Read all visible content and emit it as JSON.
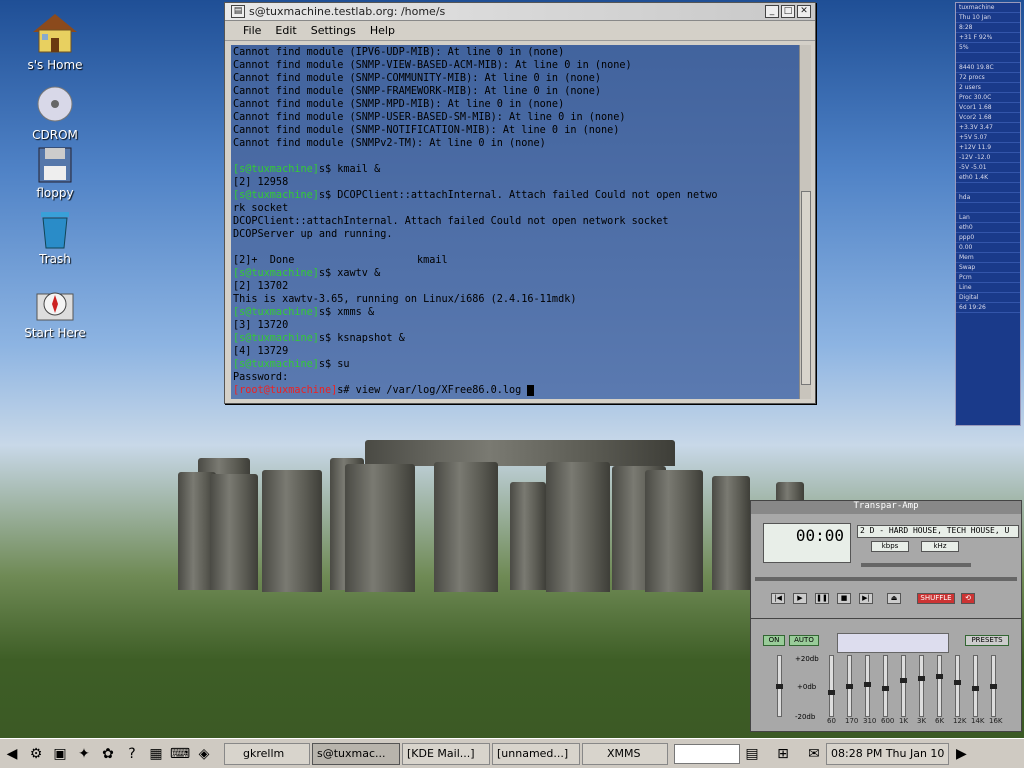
{
  "desktop": {
    "icons": [
      {
        "label": "s's Home",
        "icon": "home-icon"
      },
      {
        "label": "CDROM",
        "icon": "cdrom-icon"
      },
      {
        "label": "floppy",
        "icon": "floppy-icon"
      },
      {
        "label": "Trash",
        "icon": "trash-icon"
      },
      {
        "label": "Start Here",
        "icon": "start-here-icon"
      }
    ]
  },
  "terminal": {
    "title": "s@tuxmachine.testlab.org: /home/s",
    "menu": [
      "File",
      "Edit",
      "Settings",
      "Help"
    ],
    "lines": [
      {
        "prefix": "",
        "text": "Cannot find module (IPV6-UDP-MIB): At line 0 in (none)"
      },
      {
        "prefix": "",
        "text": "Cannot find module (SNMP-VIEW-BASED-ACM-MIB): At line 0 in (none)"
      },
      {
        "prefix": "",
        "text": "Cannot find module (SNMP-COMMUNITY-MIB): At line 0 in (none)"
      },
      {
        "prefix": "",
        "text": "Cannot find module (SNMP-FRAMEWORK-MIB): At line 0 in (none)"
      },
      {
        "prefix": "",
        "text": "Cannot find module (SNMP-MPD-MIB): At line 0 in (none)"
      },
      {
        "prefix": "",
        "text": "Cannot find module (SNMP-USER-BASED-SM-MIB): At line 0 in (none)"
      },
      {
        "prefix": "",
        "text": "Cannot find module (SNMP-NOTIFICATION-MIB): At line 0 in (none)"
      },
      {
        "prefix": "",
        "text": "Cannot find module (SNMPv2-TM): At line 0 in (none)"
      },
      {
        "prefix": "",
        "text": ""
      },
      {
        "prefix": "[s@tuxmachine]",
        "text": "s$ kmail &"
      },
      {
        "prefix": "",
        "text": "[2] 12958"
      },
      {
        "prefix": "[s@tuxmachine]",
        "text": "s$ DCOPClient::attachInternal. Attach failed Could not open netwo"
      },
      {
        "prefix": "",
        "text": "rk socket"
      },
      {
        "prefix": "",
        "text": "DCOPClient::attachInternal. Attach failed Could not open network socket"
      },
      {
        "prefix": "",
        "text": "DCOPServer up and running."
      },
      {
        "prefix": "",
        "text": ""
      },
      {
        "prefix": "",
        "text": "[2]+  Done                    kmail"
      },
      {
        "prefix": "[s@tuxmachine]",
        "text": "s$ xawtv &"
      },
      {
        "prefix": "",
        "text": "[2] 13702"
      },
      {
        "prefix": "",
        "text": "This is xawtv-3.65, running on Linux/i686 (2.4.16-11mdk)"
      },
      {
        "prefix": "[s@tuxmachine]",
        "text": "s$ xmms &"
      },
      {
        "prefix": "",
        "text": "[3] 13720"
      },
      {
        "prefix": "[s@tuxmachine]",
        "text": "s$ ksnapshot &"
      },
      {
        "prefix": "",
        "text": "[4] 13729"
      },
      {
        "prefix": "[s@tuxmachine]",
        "text": "s$ su"
      },
      {
        "prefix": "",
        "text": "Password:"
      },
      {
        "prefix": "[root@tuxmachine]",
        "text": "s# view /var/log/XFree86.0.log "
      }
    ]
  },
  "gkrellm": {
    "lines": [
      "tuxmachine",
      "Thu 10 Jan",
      "8:28",
      "+31 F  92%",
      "5%",
      "",
      "8440    19.8C",
      "72 procs",
      "2 users",
      "Proc   30.0C",
      "Vcor1   1.68",
      "Vcor2   1.68",
      "+3.3V   3.47",
      "+5V     5.07",
      "+12V    11.9",
      "-12V   -12.0",
      "-5V    -5.01",
      "eth0    1.4K",
      "",
      "hda",
      "",
      "Lan",
      "eth0",
      "ppp0",
      "0.00",
      "Mem",
      "Swap",
      "Pcm",
      "Line",
      "Digital",
      "6d 19:26"
    ]
  },
  "xmms": {
    "title": "Transpar-Amp",
    "time": "00:00",
    "song": "2 D - HARD HOUSE, TECH HOUSE, U",
    "kbps": "kbps",
    "khz": "kHz",
    "shuffle": "SHUFFLE",
    "eq_on": "ON",
    "eq_auto": "AUTO",
    "presets": "PRESETS",
    "db_top": "+20db",
    "db_mid": "+0db",
    "db_bot": "-20db",
    "bands": [
      "60",
      "170",
      "310",
      "600",
      "1K",
      "3K",
      "6K",
      "12K",
      "14K",
      "16K"
    ]
  },
  "taskbar": {
    "tasks": [
      "gkrellm",
      "s@tuxmac...",
      "[KDE Mail...]",
      "[unnamed...]",
      "XMMS"
    ],
    "clock": "08:28 PM Thu Jan 10"
  },
  "colors": {
    "prompt_user": "#33cc33",
    "prompt_root": "#ee2222",
    "terminal_bg": "#3a64a8"
  }
}
